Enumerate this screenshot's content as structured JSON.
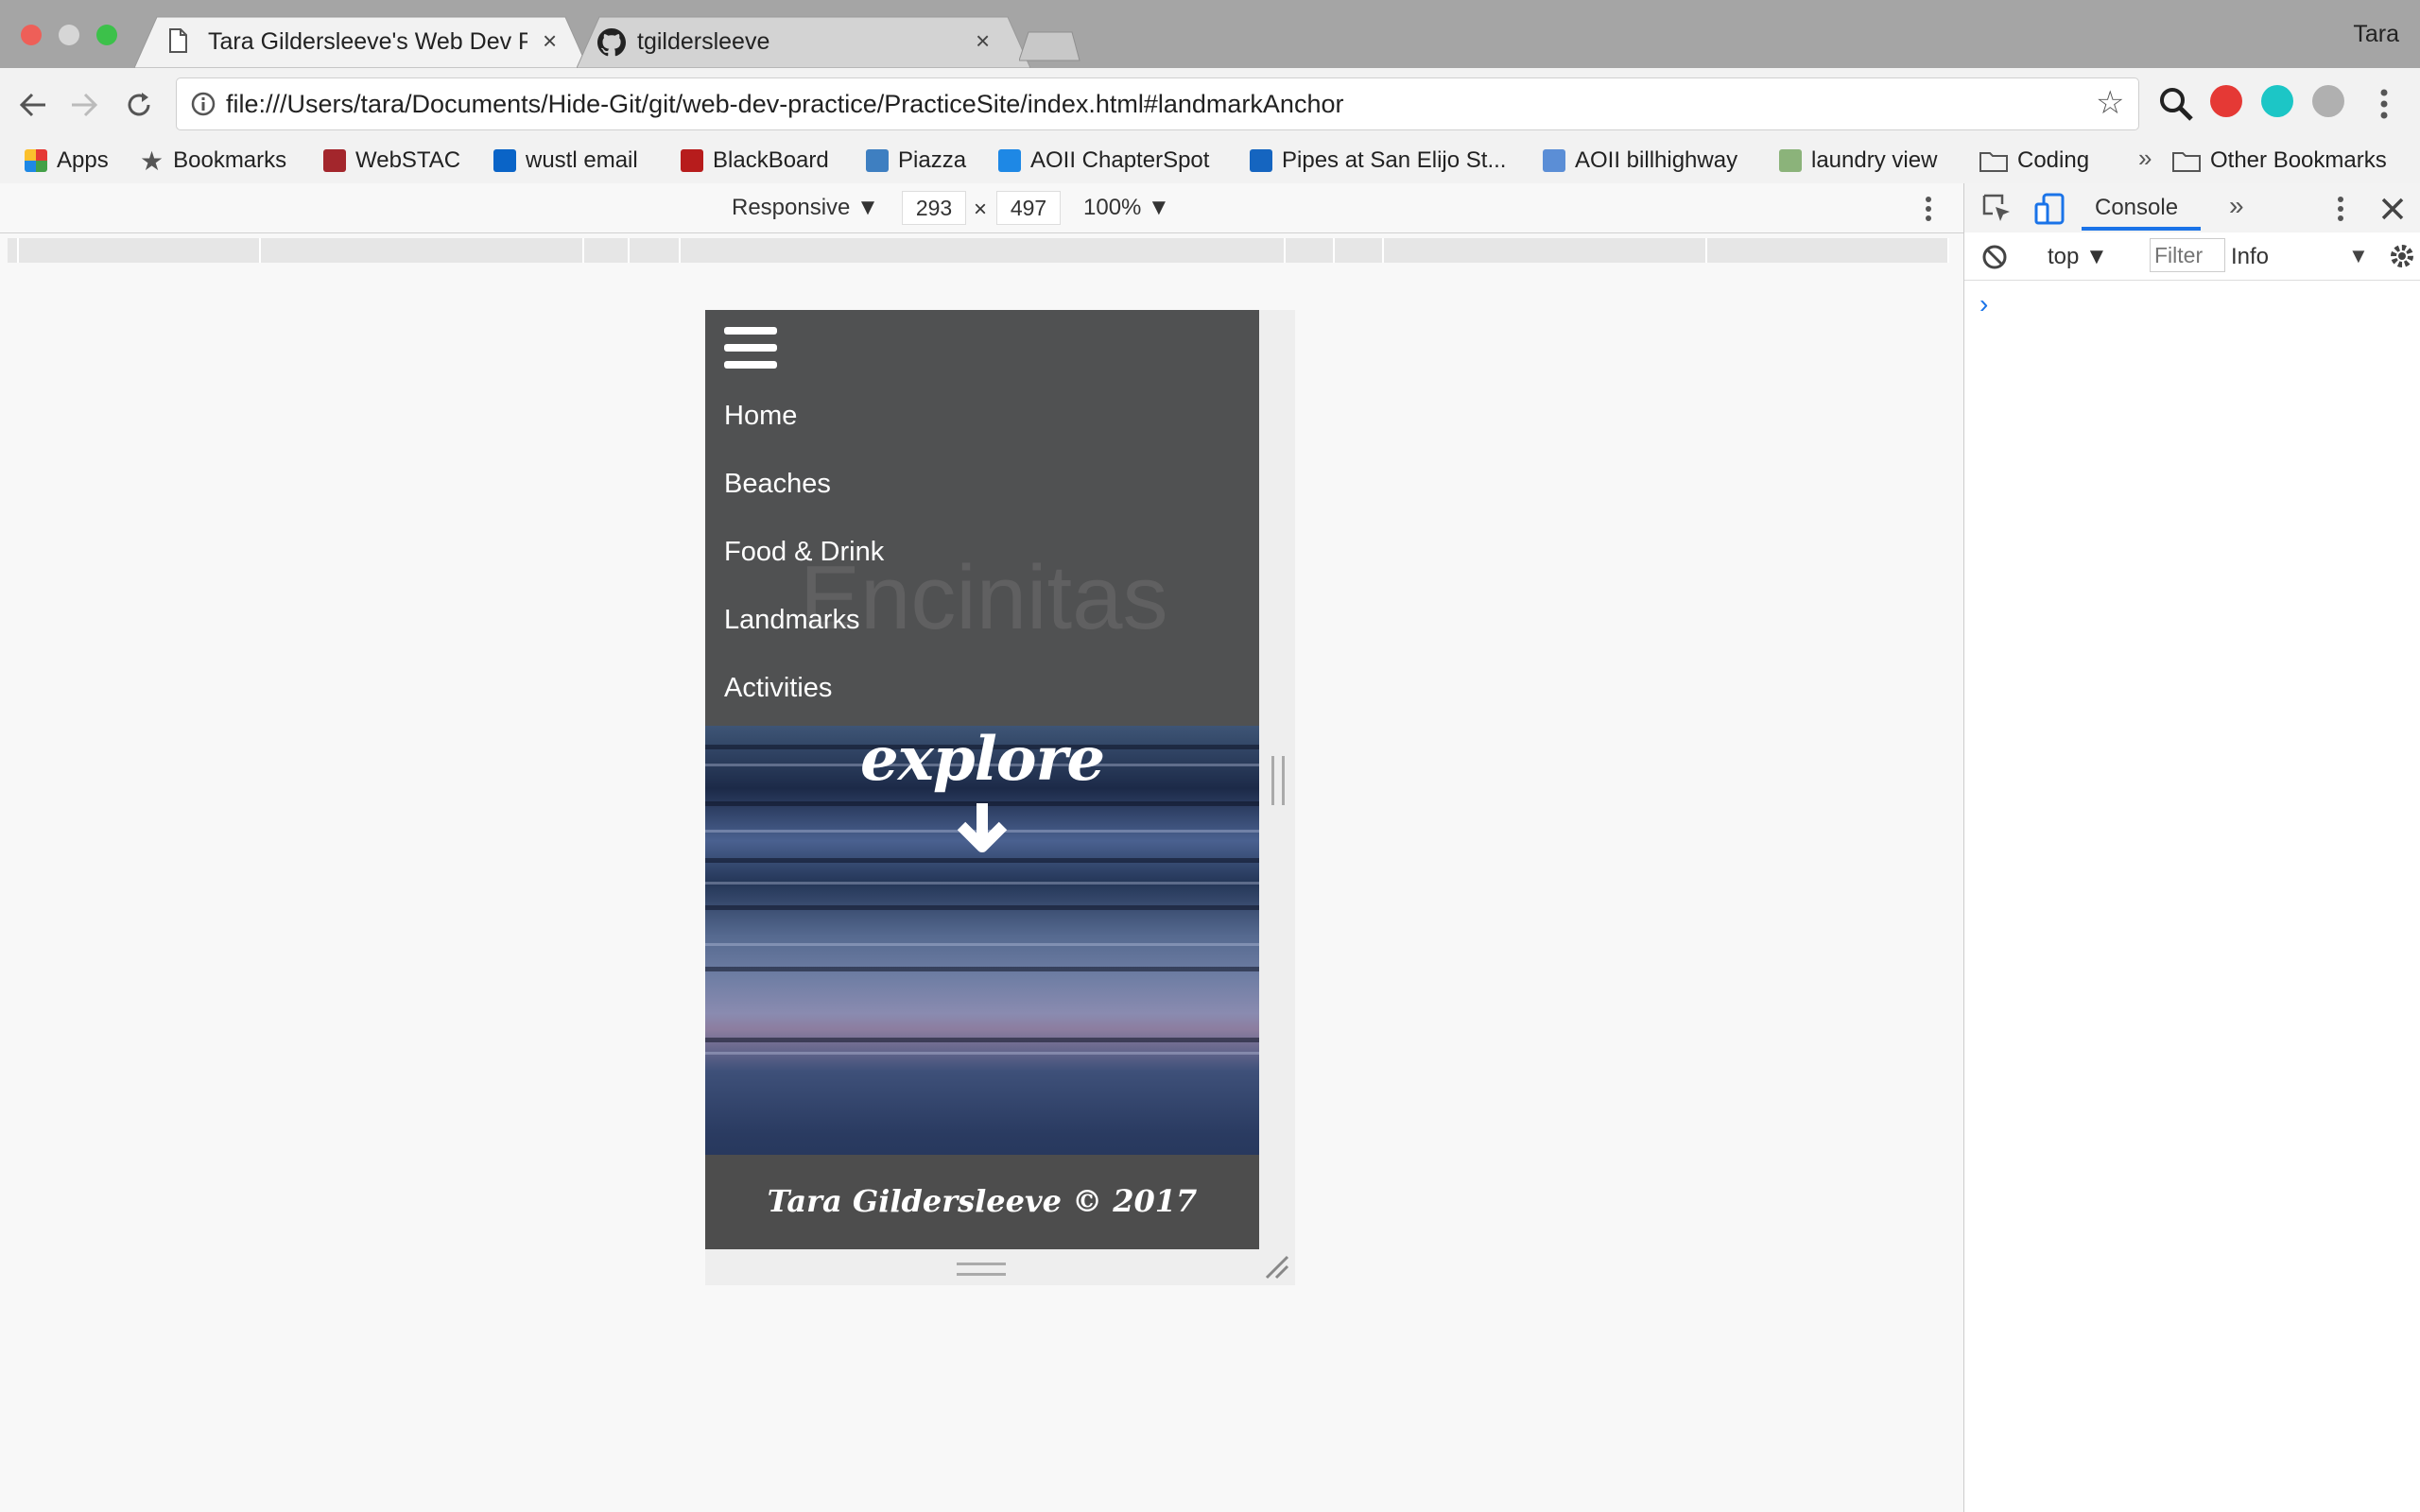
{
  "browser": {
    "profile_name": "Tara",
    "tabs": [
      {
        "title": "Tara Gildersleeve's Web Dev P",
        "close": "×",
        "active": true
      },
      {
        "title": "tgildersleeve",
        "close": "×",
        "active": false
      }
    ],
    "address_bar": {
      "url": "file:///Users/tara/Documents/Hide-Git/git/web-dev-practice/PracticeSite/index.html#landmarkAnchor"
    },
    "bookmarks": [
      {
        "label": "Apps",
        "icon": "apps-grid-icon"
      },
      {
        "label": "Bookmarks",
        "icon": "star-icon"
      },
      {
        "label": "WebSTAC",
        "icon": "webstac-icon"
      },
      {
        "label": "wustl email",
        "icon": "outlook-icon"
      },
      {
        "label": "BlackBoard",
        "icon": "blackboard-icon"
      },
      {
        "label": "Piazza",
        "icon": "piazza-icon"
      },
      {
        "label": "AOII ChapterSpot",
        "icon": "chapterspot-icon"
      },
      {
        "label": "Pipes at San Elijo St...",
        "icon": "surfline-icon"
      },
      {
        "label": "AOII billhighway",
        "icon": "billhighway-icon"
      },
      {
        "label": "laundry view",
        "icon": "laundry-icon"
      },
      {
        "label": "Coding",
        "icon": "folder-icon"
      }
    ],
    "bookmarks_overflow": "»",
    "other_bookmarks": "Other Bookmarks"
  },
  "device_toolbar": {
    "mode": "Responsive",
    "width": "293",
    "times": "×",
    "height": "497",
    "zoom": "100%"
  },
  "site": {
    "menu": [
      "Home",
      "Beaches",
      "Food & Drink",
      "Landmarks",
      "Activities"
    ],
    "ghost_title": "Encinitas",
    "explore": "explore",
    "footer": "Tara Gildersleeve © 2017"
  },
  "devtools": {
    "tab_console": "Console",
    "more_tabs": "»",
    "context": "top",
    "filter_placeholder": "Filter",
    "level": "Info",
    "prompt": "›"
  },
  "colors": {
    "accent": "#1a73e8",
    "menu_bg": "#525252",
    "footer_bg": "#4d4d4d"
  }
}
